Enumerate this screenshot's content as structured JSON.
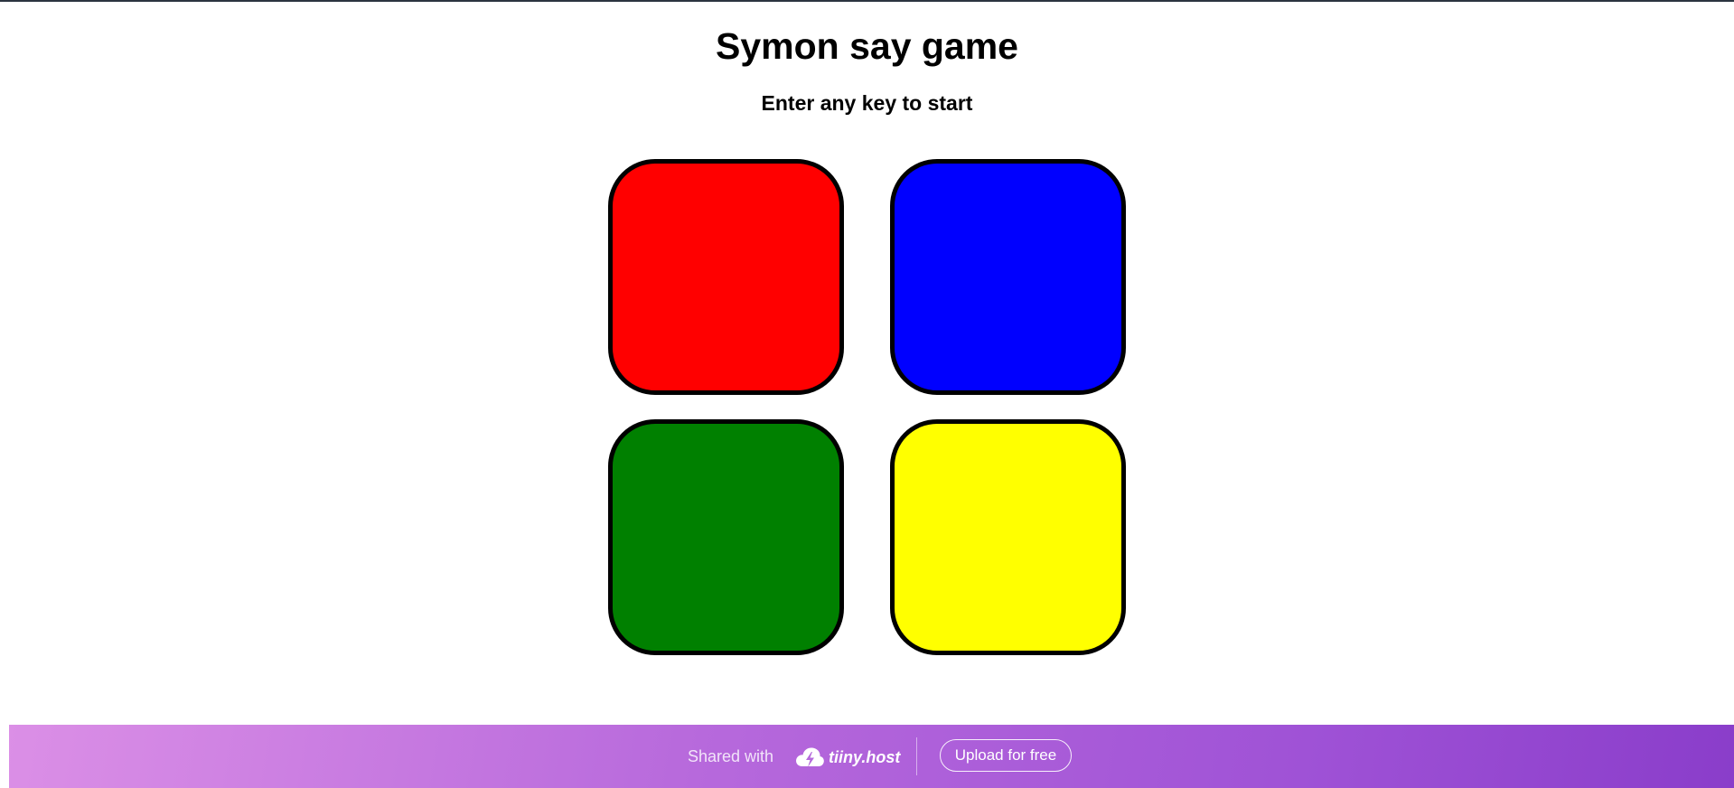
{
  "game": {
    "title": "Symon say game",
    "status": "Enter any key to start",
    "pads": [
      {
        "name": "red",
        "color": "#ff0000"
      },
      {
        "name": "blue",
        "color": "#0000ff"
      },
      {
        "name": "green",
        "color": "#008000"
      },
      {
        "name": "yellow",
        "color": "#ffff00"
      }
    ]
  },
  "footer": {
    "shared_label": "Shared with",
    "brand": "tiiny.host",
    "brand_icon": "cloud-lightning-icon",
    "upload_label": "Upload for free"
  }
}
